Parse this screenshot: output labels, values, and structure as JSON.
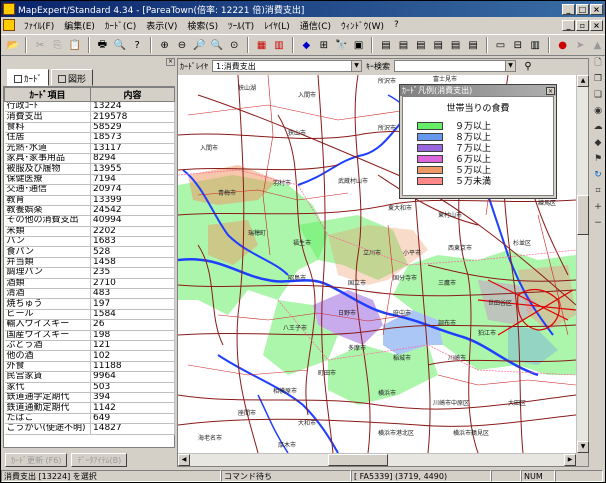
{
  "window": {
    "title": "MapExpert/Standard 4.34 - [PareaTown(倍率:  12221 倍)消費支出]"
  },
  "menu": [
    "ﾌｧｲﾙ(F)",
    "編集(E)",
    "ｶｰﾄﾞ(C)",
    "表示(V)",
    "検索(S)",
    "ﾂｰﾙ(T)",
    "ﾚｲﾔ(L)",
    "通信(C)",
    "ｳｨﾝﾄﾞｳ(W)",
    "?"
  ],
  "left_panel": {
    "tabs": [
      "ｶｰﾄﾞ",
      "図形"
    ],
    "columns": [
      "ｶｰﾄﾞ項目",
      "内容"
    ],
    "rows": [
      [
        "行政ｺｰﾄﾞ",
        "13224"
      ],
      [
        "消費支出",
        "219578"
      ],
      [
        "食料",
        "58529"
      ],
      [
        "住居",
        "18573"
      ],
      [
        "光熱･水道",
        "13117"
      ],
      [
        "家具･家事用品",
        "8294"
      ],
      [
        "被服及び履物",
        "13955"
      ],
      [
        "保健医療",
        "7194"
      ],
      [
        "交通･通信",
        "20974"
      ],
      [
        "教育",
        "13399"
      ],
      [
        "教養娯楽",
        "24542"
      ],
      [
        "その他の消費支出",
        "40994"
      ],
      [
        "米類",
        "2202"
      ],
      [
        "パン",
        "1683"
      ],
      [
        "食パン",
        "528"
      ],
      [
        "弁当類",
        "1458"
      ],
      [
        "調理パン",
        "235"
      ],
      [
        "酒類",
        "2710"
      ],
      [
        "清酒",
        "483"
      ],
      [
        "焼ちゅう",
        "197"
      ],
      [
        "ビール",
        "1584"
      ],
      [
        "輸入ウイスキー",
        "26"
      ],
      [
        "国産ウイスキー",
        "198"
      ],
      [
        "ぶどう酒",
        "121"
      ],
      [
        "他の酒",
        "102"
      ],
      [
        "外食",
        "11188"
      ],
      [
        "民営家賃",
        "9964"
      ],
      [
        "家代",
        "503"
      ],
      [
        "鉄道通学定期代",
        "394"
      ],
      [
        "鉄道通勤定期代",
        "1142"
      ],
      [
        "たばこ",
        "649"
      ],
      [
        "ごうかい(使途不明)",
        "14827"
      ]
    ],
    "buttons": [
      "ｶｰﾄﾞ更新",
      "(F6)",
      "ﾃﾞｰﾀｱｲﾃﾑ(B)"
    ]
  },
  "search": {
    "card_label": "ｶｰﾄﾞﾚｲﾔ",
    "card_value": "1:消費支出",
    "key_label": "ｷｰ検索",
    "key_value": ""
  },
  "legend": {
    "title": "ｶｰﾄﾞ凡例(消費支出)",
    "heading": "世帯当りの食費",
    "items": [
      {
        "label": "９万以上",
        "color": "#66ee66"
      },
      {
        "label": "８万以上",
        "color": "#6699ee"
      },
      {
        "label": "７万以上",
        "color": "#9966dd"
      },
      {
        "label": "６万以上",
        "color": "#dd66dd"
      },
      {
        "label": "５万以上",
        "color": "#ee9966"
      },
      {
        "label": "５万未満",
        "color": "#ff8888"
      }
    ]
  },
  "map_labels": [
    "青梅市",
    "羽村市",
    "福生市",
    "瑞穂町",
    "武蔵村山市",
    "東大和市",
    "昭島市",
    "立川市",
    "日野市",
    "八王子市",
    "町田市",
    "多摩市",
    "稲城市",
    "府中市",
    "調布市",
    "狛江市",
    "世田谷区",
    "杉並区",
    "練馬区",
    "板橋区",
    "所沢市",
    "入間市",
    "狭山市",
    "川越市",
    "和光市",
    "朝霞市",
    "志木市",
    "新座市",
    "富士見市",
    "相模原市",
    "大和市",
    "横浜市",
    "川崎市",
    "座間市",
    "海老名市",
    "厚木市",
    "東村山市",
    "清瀬市"
  ],
  "status": {
    "text": "消費支出 [13224] を選択",
    "mode": "コマンド待ち",
    "coords": "[ FA5339] (3719, 4490)",
    "num": "NUM"
  }
}
